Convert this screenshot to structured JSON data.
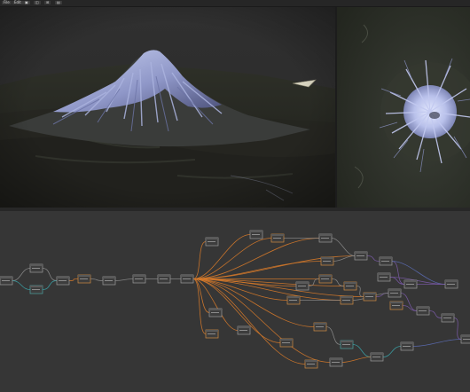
{
  "toolbar": {
    "items": [
      {
        "label": "File",
        "icon": "menu-icon"
      },
      {
        "label": "Edit",
        "icon": "menu-icon"
      },
      {
        "label": "▣",
        "icon": "view-icon"
      },
      {
        "label": "◫",
        "icon": "layout-icon"
      },
      {
        "label": "⊞",
        "icon": "grid-icon"
      },
      {
        "label": "▤",
        "icon": "panel-icon"
      }
    ]
  },
  "viewports": {
    "perspective": {
      "content": "3d-terrain-render",
      "subject": "snow-capped-volcano"
    },
    "top": {
      "content": "top-down-terrain-render"
    }
  },
  "node_graph": {
    "colors": {
      "background": "#363636",
      "node_fill": "#3d3d3d",
      "node_border_gray": "#9a9a9a",
      "node_border_orange": "#d08a40",
      "node_border_teal": "#4aa3a0",
      "wire_orange": "#d77a2a",
      "wire_gray": "#8a8a8a",
      "wire_teal": "#3aa1a6",
      "wire_purple": "#7a5aa6",
      "wire_blue": "#5a6ab0"
    }
  }
}
